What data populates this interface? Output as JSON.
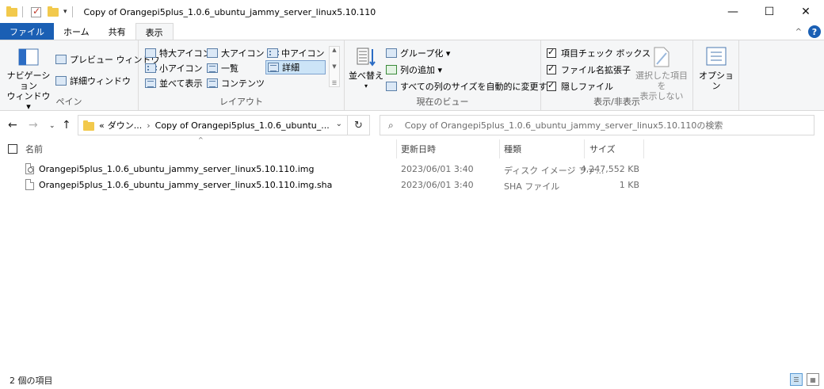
{
  "window": {
    "title": "Copy of Orangepi5plus_1.0.6_ubuntu_jammy_server_linux5.10.110",
    "minimize": "—",
    "maximize": "☐",
    "close": "✕"
  },
  "tabs": [
    {
      "label": "ファイル"
    },
    {
      "label": "ホーム"
    },
    {
      "label": "共有"
    },
    {
      "label": "表示"
    }
  ],
  "ribbon": {
    "pane": {
      "nav_pane_line1": "ナビゲーション",
      "nav_pane_line2": "ウィンドウ ▾",
      "preview": "プレビュー ウィンドウ",
      "details": "詳細ウィンドウ",
      "label": "ペイン"
    },
    "layout": {
      "items": [
        "特大アイコン",
        "大アイコン",
        "中アイコン",
        "小アイコン",
        "一覧",
        "詳細",
        "並べて表示",
        "コンテンツ"
      ],
      "selected": "詳細",
      "label": "レイアウト"
    },
    "current_view": {
      "sort": "並べ替え",
      "group_by": "グループ化 ▾",
      "add_column": "列の追加 ▾",
      "fit_columns": "すべての列のサイズを自動的に変更する",
      "label": "現在のビュー"
    },
    "show_hide": {
      "item_checkboxes": "項目チェック ボックス",
      "file_extensions": "ファイル名拡張子",
      "hidden_items": "隠しファイル",
      "hide_selected_line1": "選択した項目を",
      "hide_selected_line2": "表示しない",
      "label": "表示/非表示"
    },
    "options": "オプション"
  },
  "address": {
    "crumb_overflow": "«",
    "crumb_1": "ダウン...",
    "crumb_2": "Copy of Orangepi5plus_1.0.6_ubuntu_...",
    "search_placeholder": "Copy of Orangepi5plus_1.0.6_ubuntu_jammy_server_linux5.10.110の検索"
  },
  "columns": {
    "name": "名前",
    "date": "更新日時",
    "type": "種類",
    "size": "サイズ"
  },
  "files": [
    {
      "name": "Orangepi5plus_1.0.6_ubuntu_jammy_server_linux5.10.110.img",
      "date": "2023/06/01 3:40",
      "type": "ディスク イメージ ファ...",
      "size": "4,247,552 KB"
    },
    {
      "name": "Orangepi5plus_1.0.6_ubuntu_jammy_server_linux5.10.110.img.sha",
      "date": "2023/06/01 3:40",
      "type": "SHA ファイル",
      "size": "1 KB"
    }
  ],
  "status": {
    "count": "2 個の項目"
  },
  "colors": {
    "file_tab": "#1a5fb4",
    "selection": "#cce4f7"
  }
}
